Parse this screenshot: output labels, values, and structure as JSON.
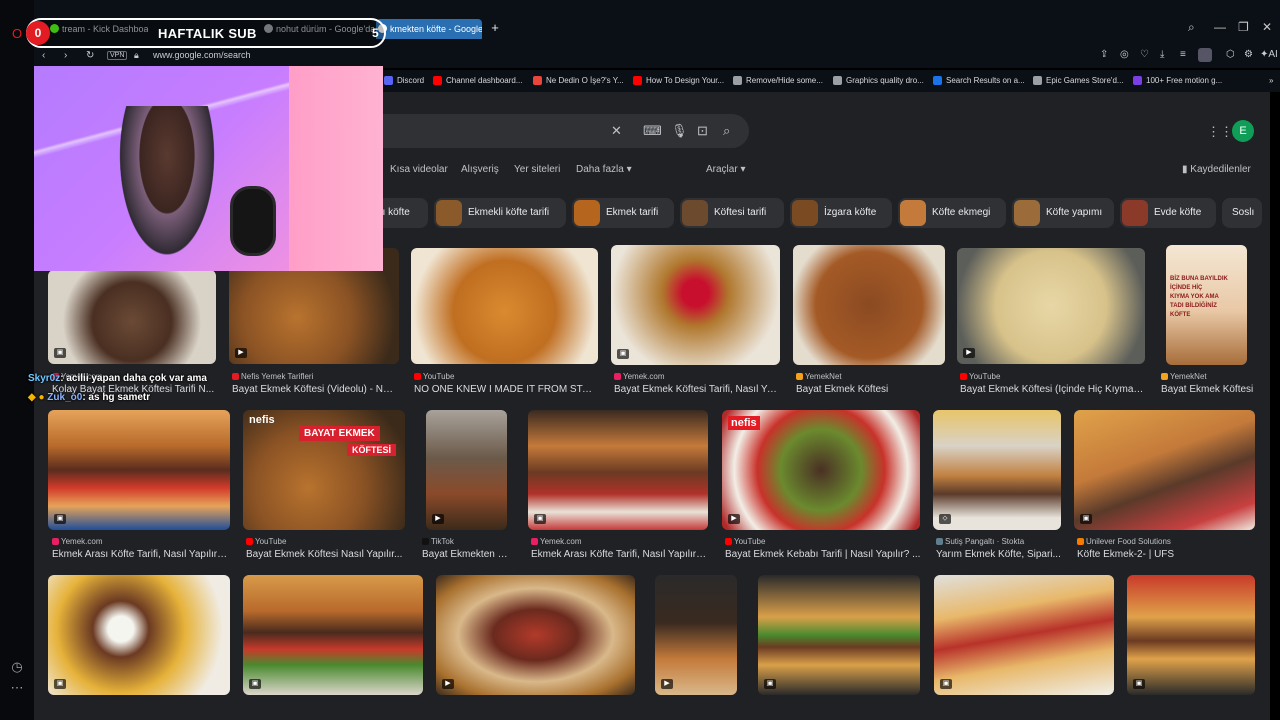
{
  "overlay": {
    "sub_count_left": "0",
    "sub_title": "HAFTALIK SUB",
    "sub_count_right": "5"
  },
  "tabs": [
    {
      "label": "tream - Kick Dashboard"
    },
    {
      "label": "nohut dürüm - Google'da"
    },
    {
      "label": "kmekten köfte - Google"
    }
  ],
  "address": {
    "vpn": "VPN",
    "url": "www.google.com/search"
  },
  "toolbar": {
    "ai_label": "AI"
  },
  "bookmarks": [
    {
      "label": "Discord",
      "color": "#5865f2"
    },
    {
      "label": "Channel dashboard...",
      "color": "#ff0000"
    },
    {
      "label": "Ne Dedin O İşe?'s Y...",
      "color": "#e8453c"
    },
    {
      "label": "How To Design Your...",
      "color": "#ff0000"
    },
    {
      "label": "Remove/Hide some...",
      "color": "#9aa0a6"
    },
    {
      "label": "Graphics quality dro...",
      "color": "#9aa0a6"
    },
    {
      "label": "Search Results on a...",
      "color": "#1a73e8"
    },
    {
      "label": "Epic Games Store'd...",
      "color": "#9aa0a6"
    },
    {
      "label": "100+ Free motion g...",
      "color": "#7b3fe4"
    }
  ],
  "search": {
    "avatar_letter": "E"
  },
  "nav_tabs": [
    "Kısa videolar",
    "Alışveriş",
    "Yer siteleri",
    "Daha fazla ▾"
  ],
  "tools_label": "Araçlar ▾",
  "saved_label": "Kaydedilenler",
  "chips": [
    {
      "label": "ası köfte"
    },
    {
      "label": "Ekmekli köfte tarifi"
    },
    {
      "label": "Ekmek tarifi"
    },
    {
      "label": "Köftesi tarifi"
    },
    {
      "label": "İzgara köfte"
    },
    {
      "label": "Köfte ekmegi"
    },
    {
      "label": "Köfte yapımı"
    },
    {
      "label": "Evde köfte"
    },
    {
      "label": "Soslı"
    }
  ],
  "results_row1": [
    {
      "source": "Yemek.com",
      "caption": "Kolay Bayat Ekmek Köftesi Tarifi N..."
    },
    {
      "source": "Nefis Yemek Tarifleri",
      "caption": "Bayat Ekmek Köftesi (Videolu) - Nef..."
    },
    {
      "source": "YouTube",
      "caption": "NO ONE KNEW I MADE IT FROM STA..."
    },
    {
      "source": "Yemek.com",
      "caption": "Bayat Ekmek Köftesi Tarifi, Nasıl Ya..."
    },
    {
      "source": "YemekNet",
      "caption": "Bayat Ekmek Köftesi"
    },
    {
      "source": "YouTube",
      "caption": "Bayat Ekmek Köftesi (İçinde Hiç Kıyma ..."
    },
    {
      "source": "YemekNet",
      "caption": "Bayat Ekmek Köftesi"
    }
  ],
  "results_row2": [
    {
      "source": "Yemek.com",
      "caption": "Ekmek Arası Köfte Tarifi, Nasıl Yapılır?..."
    },
    {
      "source": "YouTube",
      "caption": "Bayat Ekmek Köftesi Nasıl Yapılır..."
    },
    {
      "source": "TikTok",
      "caption": "Bayat Ekmekten N..."
    },
    {
      "source": "Yemek.com",
      "caption": "Ekmek Arası Köfte Tarifi, Nasıl Yapılır?..."
    },
    {
      "source": "YouTube",
      "caption": "Bayat Ekmek Kebabı Tarifi | Nasıl Yapılır? ..."
    },
    {
      "source": "Sutiş Pangaltı · Stokta",
      "caption": "Yarım Ekmek Köfte, Sipari..."
    },
    {
      "source": "Unilever Food Solutions",
      "caption": "Köfte Ekmek-2- | UFS"
    }
  ],
  "image_text": {
    "nefis_logo": "nefis",
    "bayat_ekmek": "BAYAT EKMEK",
    "koftesi": "KÖFTESİ",
    "biz_buna": "BİZ BUNA BAYILDIK\nİÇİNDE HİÇ\nKIYMA YOK AMA\nTADI BİLDİĞİNİZ\nKÖFTE"
  },
  "chat": [
    {
      "user": "Skyr0z",
      "text": ": acilii yapan daha çok var ama"
    },
    {
      "user": "Zuk_o0",
      "text": ": as hg sametr"
    }
  ],
  "colors": {
    "page_bg": "#202124",
    "accent_red": "#e31b23",
    "tab_active": "#2b6fb3"
  }
}
